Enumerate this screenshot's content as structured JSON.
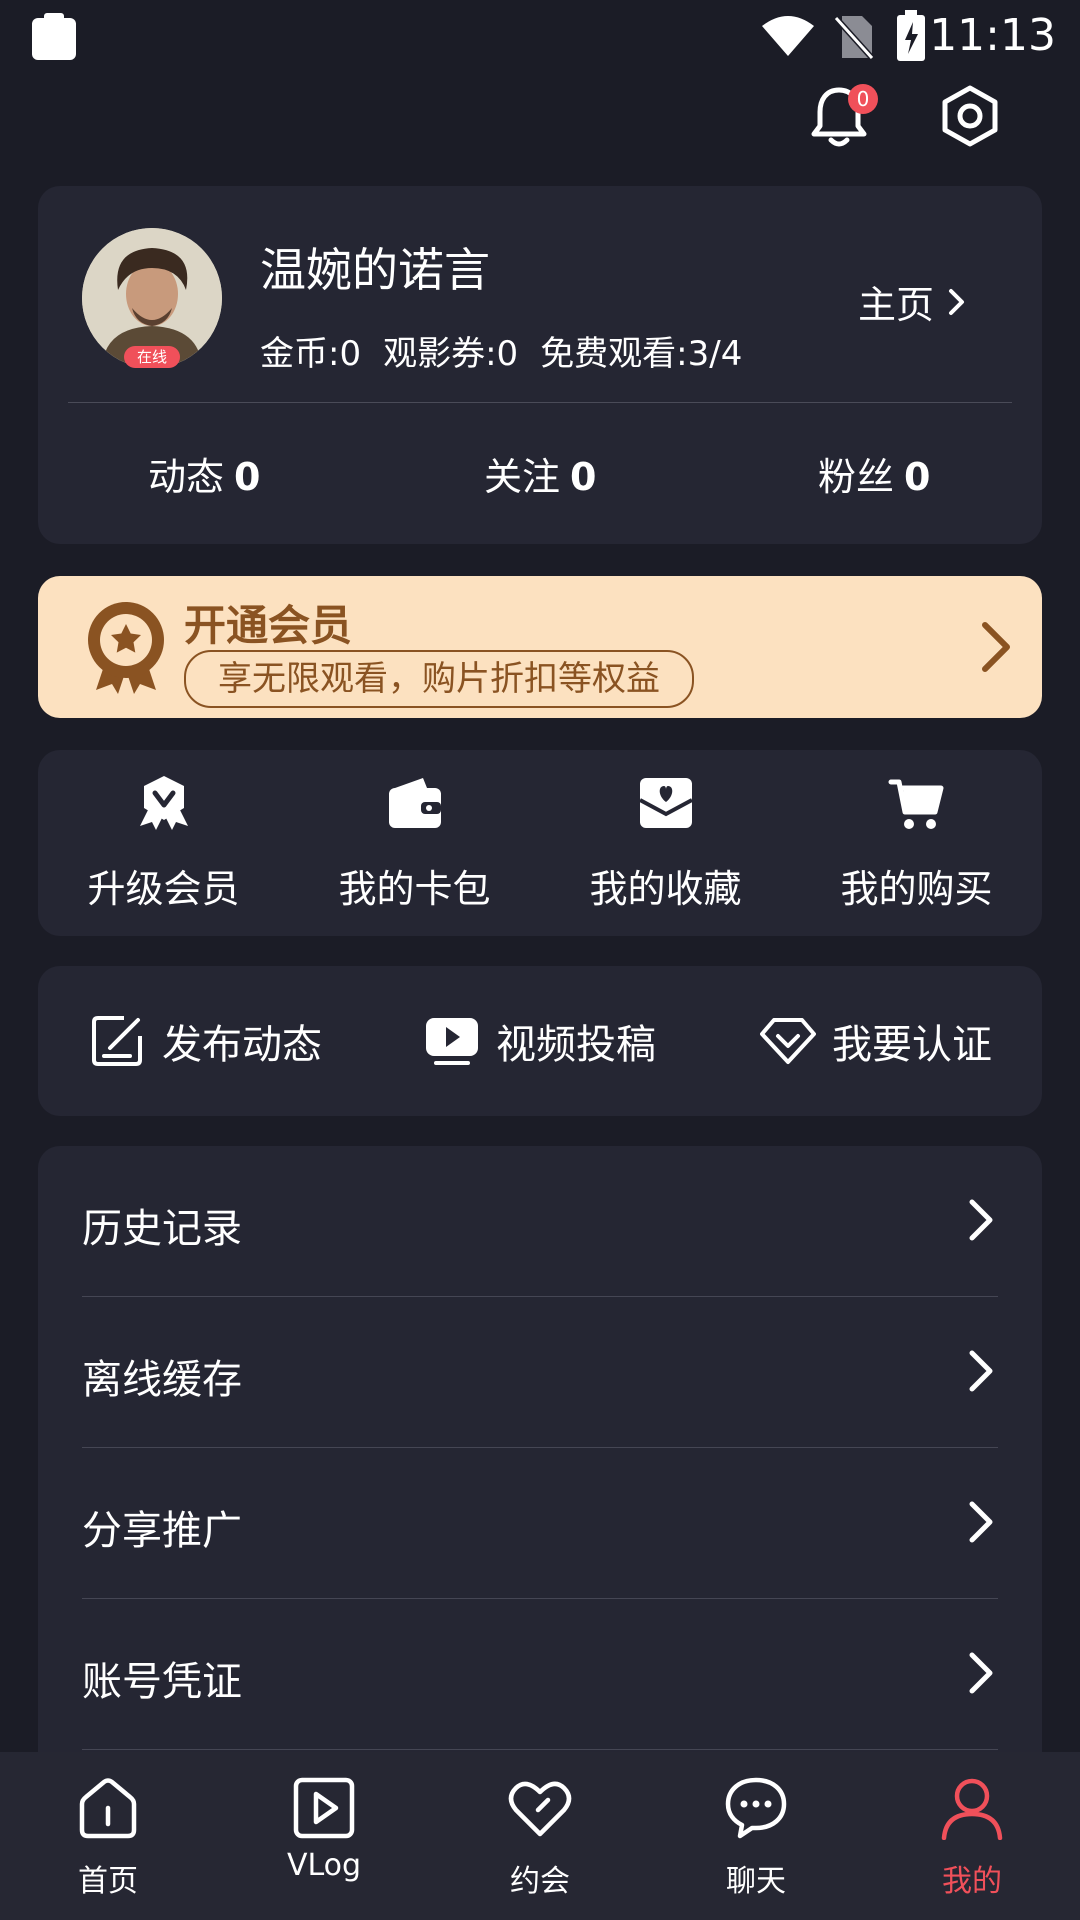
{
  "status_bar": {
    "time": "11:13"
  },
  "header": {
    "notification_count": "0"
  },
  "profile": {
    "online_label": "在线",
    "username": "温婉的诺言",
    "coins": "金币:0",
    "tickets": "观影券:0",
    "free_watch": "免费观看:3/4",
    "home_link": "主页",
    "counters": [
      {
        "label": "动态",
        "value": "0"
      },
      {
        "label": "关注",
        "value": "0"
      },
      {
        "label": "粉丝",
        "value": "0"
      }
    ]
  },
  "vip_banner": {
    "title": "开通会员",
    "subtitle": "享无限观看，购片折扣等权益"
  },
  "quick_actions": [
    {
      "label": "升级会员",
      "icon": "vip-badge-icon"
    },
    {
      "label": "我的卡包",
      "icon": "wallet-icon"
    },
    {
      "label": "我的收藏",
      "icon": "favorites-icon"
    },
    {
      "label": "我的购买",
      "icon": "cart-icon"
    }
  ],
  "creator_actions": [
    {
      "label": "发布动态",
      "icon": "edit-icon"
    },
    {
      "label": "视频投稿",
      "icon": "video-upload-icon"
    },
    {
      "label": "我要认证",
      "icon": "diamond-icon"
    }
  ],
  "menu_list": [
    {
      "label": "历史记录"
    },
    {
      "label": "离线缓存"
    },
    {
      "label": "分享推广"
    },
    {
      "label": "账号凭证"
    }
  ],
  "bottom_nav": [
    {
      "label": "首页",
      "icon": "home-icon"
    },
    {
      "label": "VLog",
      "icon": "play-icon"
    },
    {
      "label": "约会",
      "icon": "heart-icon"
    },
    {
      "label": "聊天",
      "icon": "chat-icon"
    },
    {
      "label": "我的",
      "icon": "profile-icon",
      "active": true
    }
  ],
  "colors": {
    "background": "#1b1c26",
    "card": "#252633",
    "accent": "#f0505a",
    "vip_bg": "#fce1c0",
    "vip_text": "#8a5322"
  }
}
